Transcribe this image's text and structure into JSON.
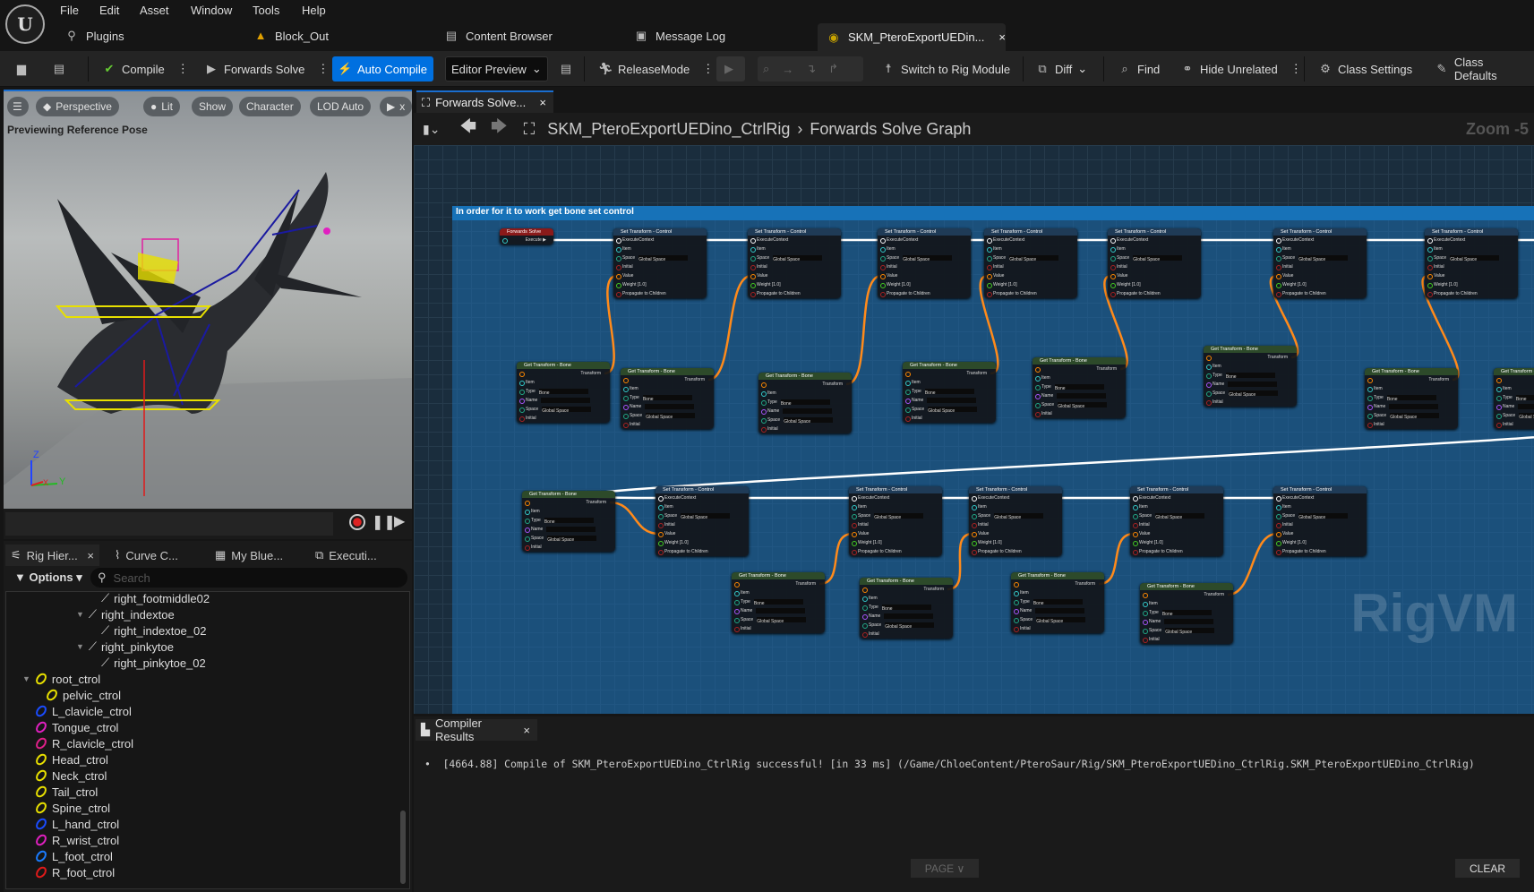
{
  "app": {
    "logo": "U",
    "menus": [
      "File",
      "Edit",
      "Asset",
      "Window",
      "Tools",
      "Help"
    ],
    "subbar": [
      {
        "icon": "plug-icon",
        "label": "Plugins"
      },
      {
        "icon": "level-icon",
        "label": "Block_Out"
      },
      {
        "icon": "folder-search-icon",
        "label": "Content Browser"
      },
      {
        "icon": "log-icon",
        "label": "Message Log"
      }
    ],
    "doc_tab": {
      "label": "SKM_PteroExportUEDin...",
      "close": "×"
    }
  },
  "toolbar": {
    "compile": "Compile",
    "forwards_solve": "Forwards Solve",
    "auto_compile": "Auto Compile",
    "editor_preview": "Editor Preview",
    "release_mode": "ReleaseMode",
    "switch_rig": "Switch to Rig Module",
    "diff": "Diff",
    "find": "Find",
    "hide_unrelated": "Hide Unrelated",
    "class_settings": "Class Settings",
    "class_defaults": "Class Defaults",
    "accent": "#0070e0"
  },
  "viewport": {
    "buttons": [
      "Perspective",
      "Lit",
      "Show",
      "Character",
      "LOD Auto"
    ],
    "play_label": "x",
    "status": "Previewing Reference Pose",
    "axes": {
      "z": "Z",
      "x": "X",
      "y": "Y"
    }
  },
  "graph": {
    "tab": "Forwards Solve...",
    "tab_close": "×",
    "crumb_asset": "SKM_PteroExportUEDino_CtrlRig",
    "crumb_graph": "Forwards Solve Graph",
    "zoom": "Zoom -5",
    "comment": "In order for it to work get bone set control",
    "watermark": "RigVM",
    "forwards_solve": {
      "title": "Forwards Solve",
      "pin": "Execute"
    },
    "set_node": {
      "title": "Set Transform - Control",
      "pins": [
        "ExecuteContext",
        "Item",
        "Space",
        "Initial",
        "Value",
        "Weight",
        "Propagate to Children"
      ],
      "weight": "1.0",
      "space": "Global Space"
    },
    "get_node": {
      "title": "Get Transform - Bone",
      "pins": [
        "Transform",
        "Item",
        "Type",
        "Name",
        "Space",
        "Initial"
      ],
      "type": "Bone",
      "space": "Global Space"
    },
    "wire_exec": "#ffffff",
    "wire_transform": "#ff8a1a"
  },
  "left_panel": {
    "tabs": [
      "Rig Hier...",
      "Curve C...",
      "My Blue...",
      "Executi..."
    ],
    "tab_close": "×",
    "options": "Options",
    "search_placeholder": "Search",
    "tree": [
      {
        "label": "right_footmiddle02",
        "kind": "bone",
        "level": 3
      },
      {
        "label": "right_indextoe",
        "kind": "bone",
        "level": 2,
        "expanded": true
      },
      {
        "label": "right_indextoe_02",
        "kind": "bone",
        "level": 3
      },
      {
        "label": "right_pinkytoe",
        "kind": "bone",
        "level": 2,
        "expanded": true
      },
      {
        "label": "right_pinkytoe_02",
        "kind": "bone",
        "level": 3
      },
      {
        "label": "root_ctrol",
        "kind": "control",
        "level": 0,
        "expanded": true,
        "color": "#e8e000"
      },
      {
        "label": "pelvic_ctrol",
        "kind": "control",
        "level": 1,
        "color": "#e8e000"
      },
      {
        "label": "L_clavicle_ctrol",
        "kind": "control",
        "level": 0,
        "color": "#1a4cff"
      },
      {
        "label": "Tongue_ctrol",
        "kind": "control",
        "level": 0,
        "color": "#e020c0"
      },
      {
        "label": "R_clavicle_ctrol",
        "kind": "control",
        "level": 0,
        "color": "#e0208a"
      },
      {
        "label": "Head_ctrol",
        "kind": "control",
        "level": 0,
        "color": "#e8e000"
      },
      {
        "label": "Neck_ctrol",
        "kind": "control",
        "level": 0,
        "color": "#e8e000"
      },
      {
        "label": "Tail_ctrol",
        "kind": "control",
        "level": 0,
        "color": "#e8e000"
      },
      {
        "label": "Spine_ctrol",
        "kind": "control",
        "level": 0,
        "color": "#e8e000"
      },
      {
        "label": "L_hand_ctrol",
        "kind": "control",
        "level": 0,
        "color": "#1a4cff"
      },
      {
        "label": "R_wrist_ctrol",
        "kind": "control",
        "level": 0,
        "color": "#e020c0"
      },
      {
        "label": "L_foot_ctrol",
        "kind": "control",
        "level": 0,
        "color": "#1a7cff"
      },
      {
        "label": "R_foot_ctrol",
        "kind": "control",
        "level": 0,
        "color": "#e01a1a"
      }
    ]
  },
  "compiler": {
    "tab": "Compiler Results",
    "tab_close": "×",
    "messages": [
      "[4664.88] Compile of SKM_PteroExportUEDino_CtrlRig successful! [in 33 ms] (/Game/ChloeContent/PteroSaur/Rig/SKM_PteroExportUEDino_CtrlRig.SKM_PteroExportUEDino_CtrlRig)"
    ],
    "page": "PAGE ∨",
    "clear": "CLEAR"
  }
}
